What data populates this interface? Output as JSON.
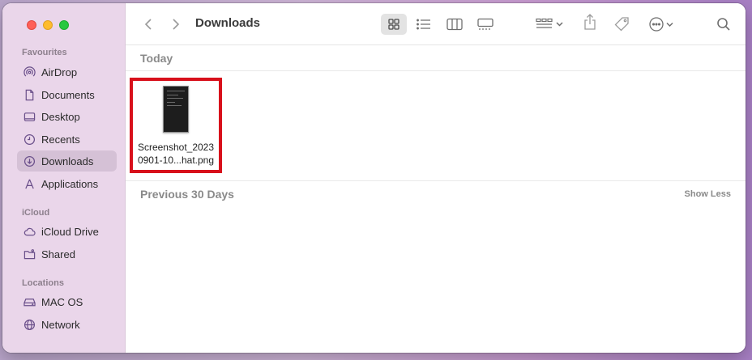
{
  "window": {
    "title": "Downloads"
  },
  "sidebar": {
    "sections": [
      {
        "label": "Favourites"
      },
      {
        "label": "iCloud"
      },
      {
        "label": "Locations"
      }
    ],
    "items": [
      {
        "label": "AirDrop",
        "icon": "airdrop-icon"
      },
      {
        "label": "Documents",
        "icon": "document-icon"
      },
      {
        "label": "Desktop",
        "icon": "desktop-icon"
      },
      {
        "label": "Recents",
        "icon": "clock-icon"
      },
      {
        "label": "Downloads",
        "icon": "download-icon",
        "selected": true
      },
      {
        "label": "Applications",
        "icon": "applications-icon"
      },
      {
        "label": "iCloud Drive",
        "icon": "cloud-icon"
      },
      {
        "label": "Shared",
        "icon": "shared-folder-icon"
      },
      {
        "label": "MAC OS",
        "icon": "disk-icon"
      },
      {
        "label": "Network",
        "icon": "globe-icon"
      }
    ]
  },
  "toolbar": {
    "icons": [
      "back-chevron-icon",
      "forward-chevron-icon",
      "icon-view-icon",
      "list-view-icon",
      "column-view-icon",
      "gallery-view-icon",
      "group-by-icon",
      "share-icon",
      "tag-icon",
      "more-actions-icon",
      "search-icon"
    ]
  },
  "content": {
    "groups": [
      {
        "label": "Today",
        "files": [
          {
            "name_line1": "Screenshot_2023",
            "name_line2": "0901-10...hat.png"
          }
        ]
      },
      {
        "label": "Previous 30 Days",
        "action": "Show Less"
      }
    ]
  },
  "colors": {
    "highlight_border": "#d8101b",
    "sidebar_bg": "#ead6ea",
    "selected_item_bg": "#d5c1d6"
  }
}
